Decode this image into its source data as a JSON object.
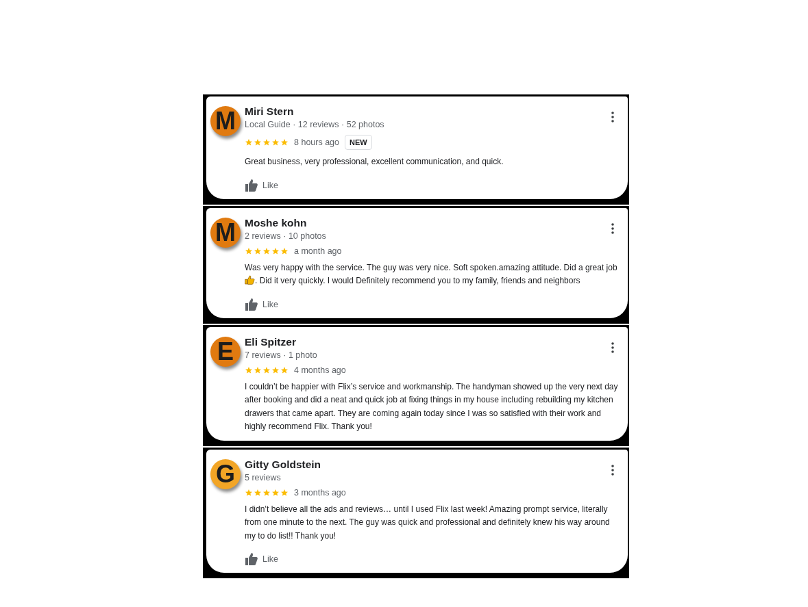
{
  "reviews": [
    {
      "initial": "M",
      "color": "#e07a10",
      "name": "Miri Stern",
      "meta": "Local Guide · 12 reviews · 52 photos",
      "stars": 5,
      "time": "8 hours ago",
      "badge": "NEW",
      "body": [
        "Great business, very professional, excellent communication, and quick."
      ],
      "like": "Like"
    },
    {
      "initial": "M",
      "color": "#e07a10",
      "name": "Moshe kohn",
      "meta": "2 reviews · 10 photos",
      "stars": 5,
      "time": "a month ago",
      "body": [
        "Was very happy with the service. The guy was very nice. Soft spoken.amazing attitude. Did a great job",
        ". Did it very quickly. I would Definitely recommend you to my family, friends and neighbors"
      ],
      "like": "Like"
    },
    {
      "initial": "E",
      "color": "#e07a10",
      "name": "Eli Spitzer",
      "meta": "7 reviews · 1 photo",
      "stars": 5,
      "time": "4 months ago",
      "body": [
        "I couldn’t be happier with Flix’s service and workmanship. The handyman showed up the very next day after booking and did a neat and quick job at fixing things in my house including rebuilding my kitchen drawers that came apart. They are coming again today since I was so satisfied with their work and highly recommend Flix. Thank you!"
      ]
    },
    {
      "initial": "G",
      "color": "#f2a526",
      "name": "Gitty Goldstein",
      "meta": "5 reviews",
      "stars": 5,
      "time": "3 months ago",
      "body": [
        "I didn’t believe all the ads and reviews… until I used Flix last week! Amazing prompt service, literally from one minute to the next. The guy was quick and professional and definitely knew his way around my to do list!! Thank you!"
      ],
      "like": "Like"
    }
  ]
}
